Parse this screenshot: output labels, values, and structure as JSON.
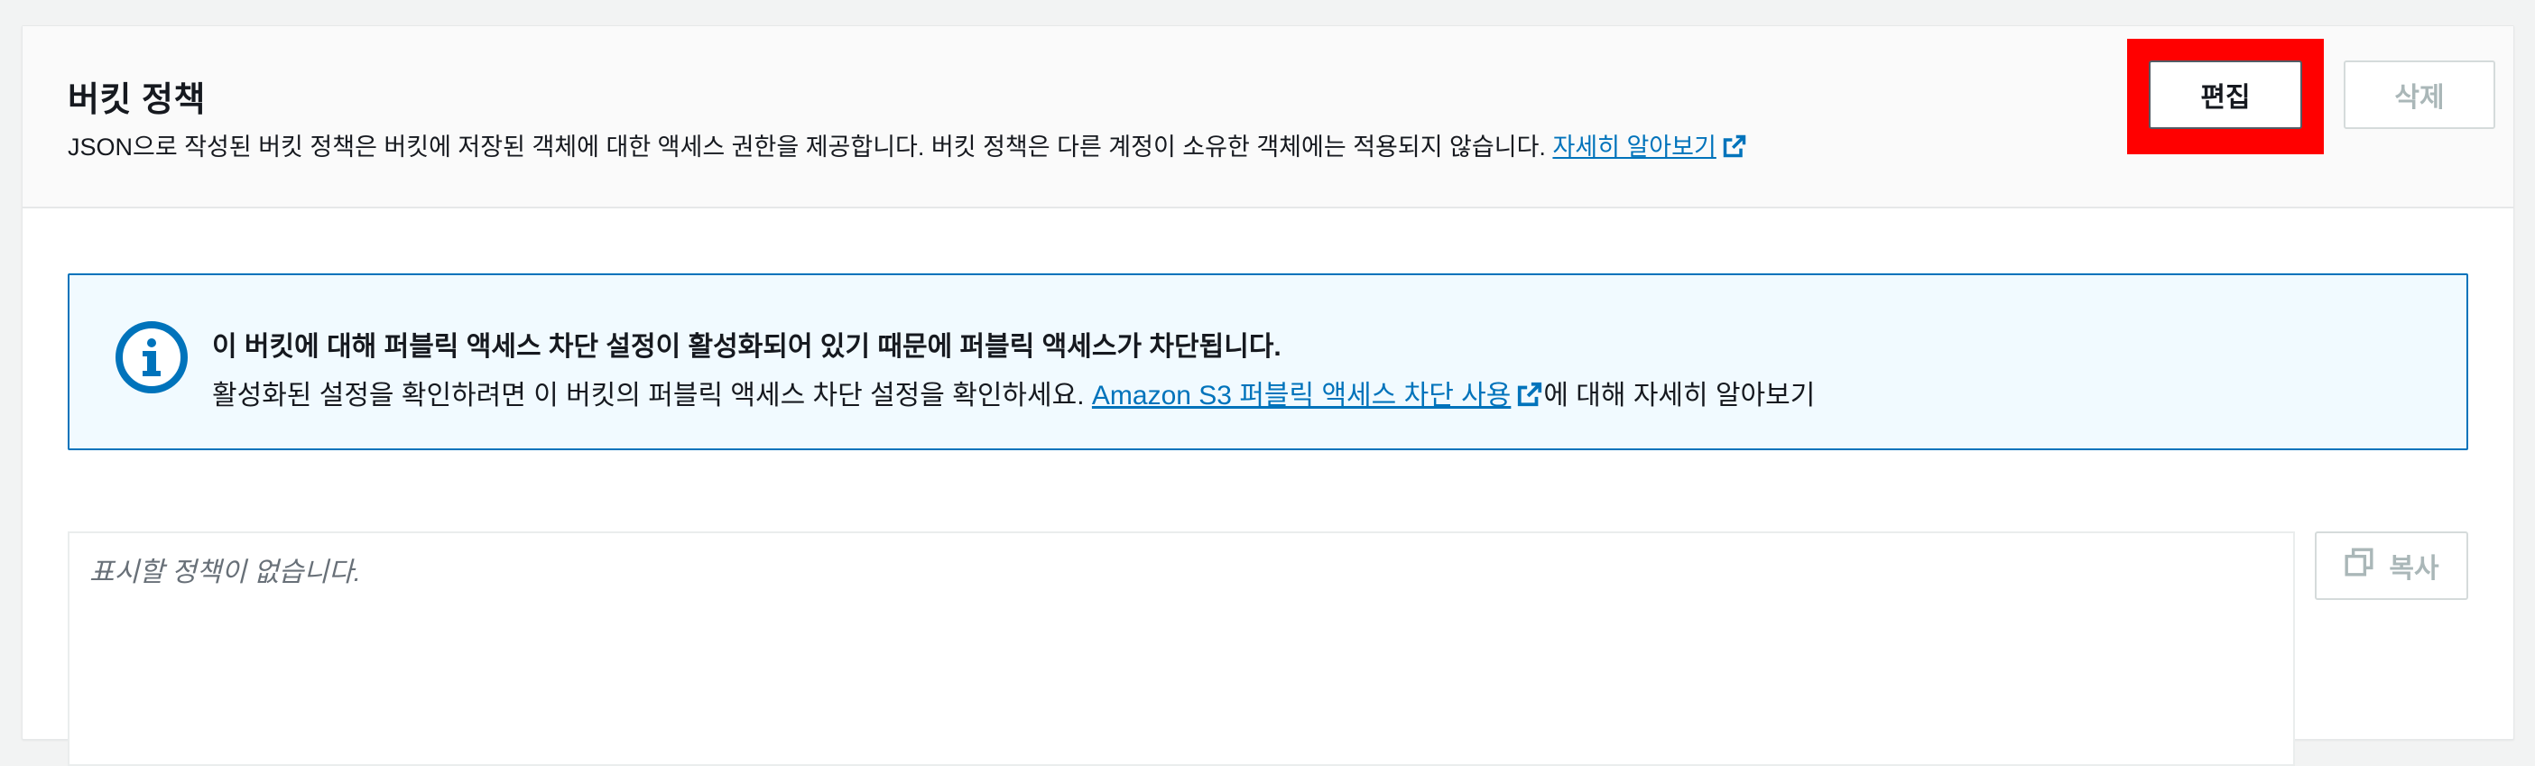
{
  "panel": {
    "title": "버킷 정책",
    "description": "JSON으로 작성된 버킷 정책은 버킷에 저장된 객체에 대한 액세스 권한을 제공합니다. 버킷 정책은 다른 계정이 소유한 객체에는 적용되지 않습니다.",
    "learn_more": "자세히 알아보기",
    "edit_label": "편집",
    "delete_label": "삭제"
  },
  "alert": {
    "title": "이 버킷에 대해 퍼블릭 액세스 차단 설정이 활성화되어 있기 때문에 퍼블릭 액세스가 차단됩니다.",
    "body_prefix": "활성화된 설정을 확인하려면 이 버킷의 퍼블릭 액세스 차단 설정을 확인하세요.",
    "link_text": "Amazon S3 퍼블릭 액세스 차단 사용",
    "body_suffix": "에 대해 자세히 알아보기"
  },
  "policy": {
    "empty_text": "표시할 정책이 없습니다.",
    "copy_label": "복사"
  },
  "colors": {
    "link": "#0073bb",
    "highlight": "#ff0000",
    "alert_bg": "#f1faff",
    "alert_border": "#0073bb",
    "disabled_text": "#aab7b8"
  },
  "icons": [
    "external-link-icon",
    "info-icon",
    "copy-icon"
  ]
}
